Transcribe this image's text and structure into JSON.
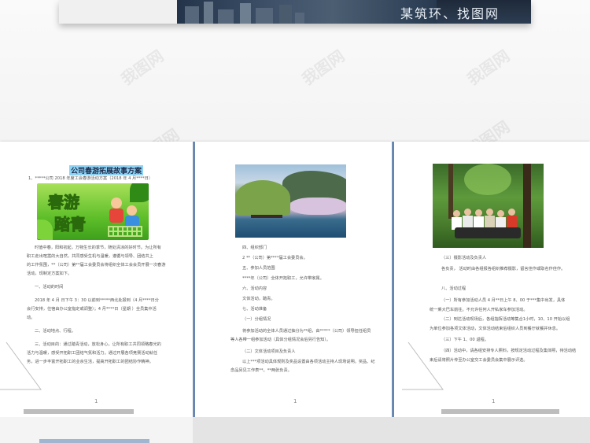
{
  "banner": {
    "text": "某筑环、找图网"
  },
  "watermark": {
    "text": "我图网"
  },
  "page1": {
    "title": "公司春游拓展故事方案",
    "subtitle": "1、*****公司 2018 年度工会春游活动方案（2018 年 4 月****日）",
    "image_label_line1": "春游",
    "image_label_line2": "踏青",
    "paragraphs": [
      "时值中春，阳和初起，万物生长的季节，随处清凉的好时节。为让所有",
      "职工走出喧嚣的大自然，共同感受生机与温暖，遵循与领导、团结共上",
      "的工作氛围，**（公司）第**届工会委员会将组织全体工会会员开展一次春游",
      "活动，现制定方案如下。",
      "一、活动的时间",
      "2018 年 4 月 日下午 3：30 以前到*****西北处报到（4 月****日分",
      "会行安排，住宿由办公室指定或调整）；4 月****日（星期 ）全员集中活",
      "动。",
      "二、活动地点、行程。",
      "三、活动目的：通过踏青活动，放松身心，让所有职工共同领略春光的",
      "活力与温暖，感受开拓职工团结气氛和活力。通过开展各项竞赛活动就任",
      "务，进一步丰富开拓职工的业余生活，提高开拓职工的团结协作精神。"
    ]
  },
  "page2": {
    "paragraphs": [
      "四、组织部门",
      "2 **（公司）第****届工会委员会。",
      "五、参加人员范围",
      "****年（公司）全体开拓职工，允许带家属。",
      "六、活动内容",
      "文体活动，踏青。",
      "七、活动准备",
      "（一）分组情况",
      "将参加活动的全体人员通过抽分为**组，由*****（公司）领导担任组员",
      "等人各带一组参加活动（具体分组情况会后另行告知）。",
      "（二）文体活动项目及负责人",
      "以上***项活动具体规则及奖品设置由各项活动主持人现场说明。奖品、纪",
      "念品另见工作表**。**两张负责。"
    ]
  },
  "page3": {
    "paragraphs": [
      "（三）摄影活动及负责人",
      "各负责，  活动时由各组报各组织推荐摄影，留言佳作或取名作佳作。",
      "八、活动过程",
      "（一）所有参加活动人员 4 月**日上午 8、00 于***集中出发，具体",
      "统一乘大巴车前往。不允许任何人开私家车参加活动。",
      "（二）到达活动现场后，各组指挥活动等集合1小时，10、10 开始以组",
      "为单位参加各项文体活动，文体活动结束后组织人员到餐厅就餐并休息。",
      "（三）下午 1、00 返程。",
      "（四）活动中，请各组安排专人照料，按规定活动过程及集体照，待活动结",
      "束后请将照片传至办公室交工会委员会集中展示评选。"
    ]
  },
  "page_numbers": {
    "p1": "1",
    "p2": "1",
    "p3": "1"
  },
  "colors": {
    "page_bar": "#3a5a8a",
    "title_highlight": "#8fd3f4",
    "divider": "#6f8fb8"
  }
}
